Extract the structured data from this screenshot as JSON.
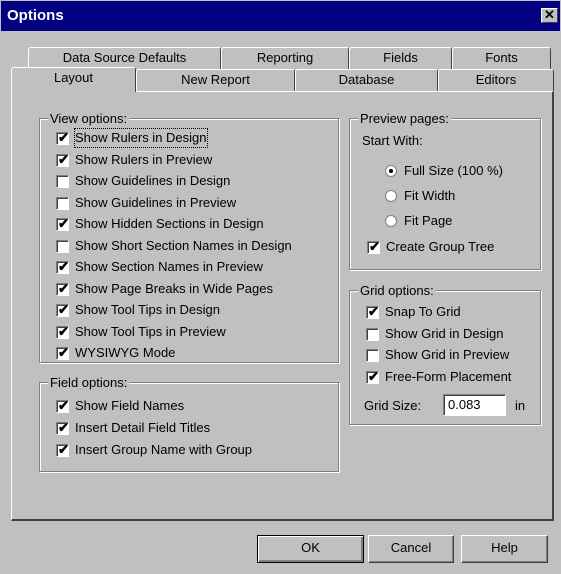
{
  "window": {
    "title": "Options",
    "close_glyph": "✕"
  },
  "tabs_back": [
    "Data Source Defaults",
    "Reporting",
    "Fields",
    "Fonts"
  ],
  "tabs_front": [
    "Layout",
    "New Report",
    "Database",
    "Editors"
  ],
  "active_tab": "Layout",
  "view_options": {
    "legend": "View options:",
    "items": [
      {
        "label": "Show Rulers in Design",
        "checked": true
      },
      {
        "label": "Show Rulers in Preview",
        "checked": true
      },
      {
        "label": "Show Guidelines in Design",
        "checked": false
      },
      {
        "label": "Show Guidelines in Preview",
        "checked": false
      },
      {
        "label": "Show Hidden Sections in Design",
        "checked": true
      },
      {
        "label": "Show Short Section Names in Design",
        "checked": false
      },
      {
        "label": "Show Section Names in Preview",
        "checked": true
      },
      {
        "label": "Show Page Breaks in Wide Pages",
        "checked": true
      },
      {
        "label": "Show Tool Tips in Design",
        "checked": true
      },
      {
        "label": "Show Tool Tips in Preview",
        "checked": true
      },
      {
        "label": "WYSIWYG Mode",
        "checked": true
      }
    ]
  },
  "field_options": {
    "legend": "Field options:",
    "items": [
      {
        "label": "Show Field Names",
        "checked": true
      },
      {
        "label": "Insert Detail Field Titles",
        "checked": true
      },
      {
        "label": "Insert Group Name with Group",
        "checked": true
      }
    ]
  },
  "preview_pages": {
    "legend": "Preview pages:",
    "start_with": "Start With:",
    "radios": [
      {
        "label": "Full Size (100 %)",
        "selected": true
      },
      {
        "label": "Fit Width",
        "selected": false
      },
      {
        "label": "Fit Page",
        "selected": false
      }
    ],
    "create_group_tree": {
      "label": "Create Group Tree",
      "checked": true
    }
  },
  "grid_options": {
    "legend": "Grid options:",
    "items": [
      {
        "label": "Snap To Grid",
        "checked": true
      },
      {
        "label": "Show Grid in Design",
        "checked": false
      },
      {
        "label": "Show Grid in Preview",
        "checked": false
      },
      {
        "label": "Free-Form Placement",
        "checked": true
      }
    ],
    "grid_size_label": "Grid Size:",
    "grid_size_value": "0.083",
    "grid_size_unit": "in"
  },
  "buttons": {
    "ok": "OK",
    "cancel": "Cancel",
    "help": "Help"
  },
  "check_glyph": "✔"
}
